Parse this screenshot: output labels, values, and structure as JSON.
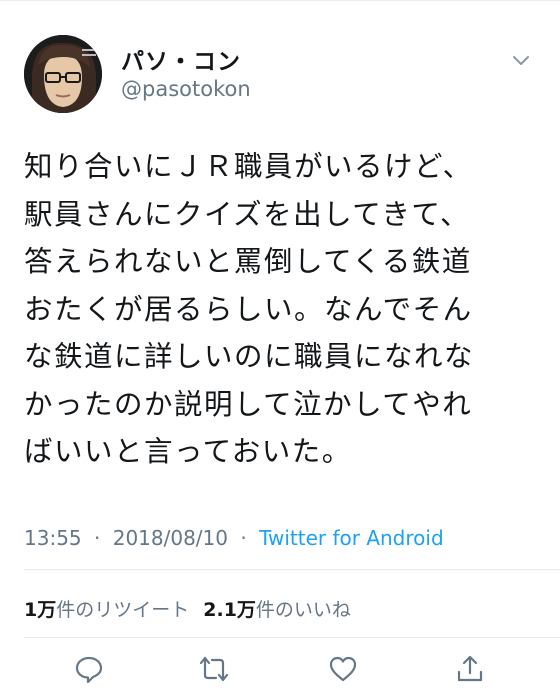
{
  "author": {
    "display_name": "パソ・コン",
    "handle": "@pasotokon"
  },
  "tweet": {
    "lines": [
      "知り合いにＪＲ職員がいるけど、",
      "駅員さんにクイズを出してきて、",
      "答えられないと罵倒してくる鉄道",
      "おたくが居るらしい。なんでそん",
      "な鉄道に詳しいのに職員になれな",
      "かったのか説明して泣かしてやれ",
      "ばいいと言っておいた。"
    ]
  },
  "meta": {
    "time": "13:55",
    "date": "2018/08/10",
    "separator": "·",
    "client": "Twitter for Android"
  },
  "stats": {
    "retweets_count": "1万",
    "retweets_label": "件のリツイート",
    "likes_count": "2.1万",
    "likes_label": "件のいいね"
  },
  "icons": {
    "reply": "reply-icon",
    "retweet": "retweet-icon",
    "like": "heart-icon",
    "share": "share-icon",
    "menu": "chevron-down-icon"
  },
  "colors": {
    "text": "#14171a",
    "secondary": "#657786",
    "link": "#1da1f2",
    "divider": "#e6ecf0"
  }
}
